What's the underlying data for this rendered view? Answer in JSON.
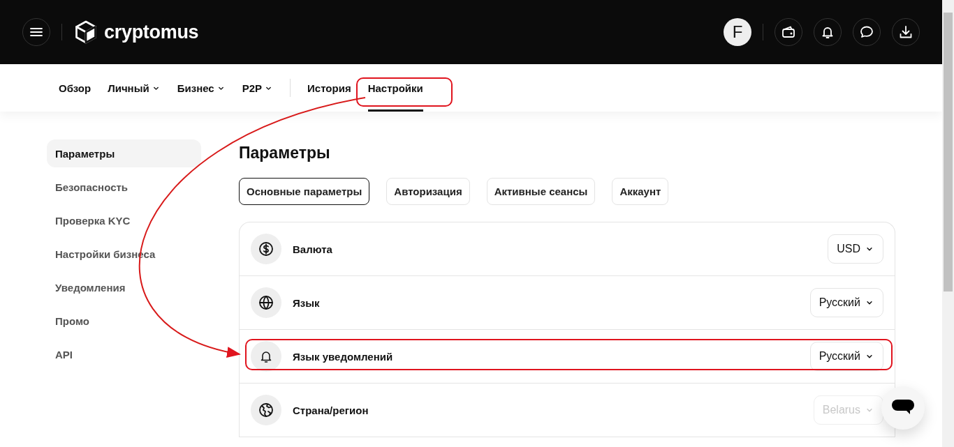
{
  "header": {
    "brand": "cryptomus",
    "avatar_letter": "F"
  },
  "nav": [
    {
      "label": "Обзор",
      "dropdown": false,
      "selected": false,
      "highlighted": false
    },
    {
      "label": "Личный",
      "dropdown": true,
      "selected": false,
      "highlighted": false
    },
    {
      "label": "Бизнес",
      "dropdown": true,
      "selected": false,
      "highlighted": false
    },
    {
      "label": "P2P",
      "dropdown": true,
      "selected": false,
      "highlighted": false
    },
    {
      "label": "История",
      "dropdown": false,
      "selected": false,
      "highlighted": false
    },
    {
      "label": "Настройки",
      "dropdown": false,
      "selected": true,
      "highlighted": true
    }
  ],
  "sidebar": {
    "items": [
      {
        "label": "Параметры",
        "selected": true
      },
      {
        "label": "Безопасность",
        "selected": false
      },
      {
        "label": "Проверка KYC",
        "selected": false
      },
      {
        "label": "Настройки бизнеса",
        "selected": false
      },
      {
        "label": "Уведомления",
        "selected": false
      },
      {
        "label": "Промо",
        "selected": false
      },
      {
        "label": "API",
        "selected": false
      }
    ]
  },
  "page_title": "Параметры",
  "tabs": [
    {
      "label": "Основные параметры",
      "selected": true
    },
    {
      "label": "Авторизация",
      "selected": false
    },
    {
      "label": "Активные сеансы",
      "selected": false
    },
    {
      "label": "Аккаунт",
      "selected": false
    }
  ],
  "settings": [
    {
      "kind": "currency",
      "label": "Валюта",
      "value": "USD",
      "disabled": false,
      "highlighted": false
    },
    {
      "kind": "language",
      "label": "Язык",
      "value": "Русский",
      "disabled": false,
      "highlighted": false
    },
    {
      "kind": "notification",
      "label": "Язык уведомлений",
      "value": "Русский",
      "disabled": false,
      "highlighted": true
    },
    {
      "kind": "country",
      "label": "Страна/регион",
      "value": "Belarus",
      "disabled": true,
      "highlighted": false
    }
  ]
}
